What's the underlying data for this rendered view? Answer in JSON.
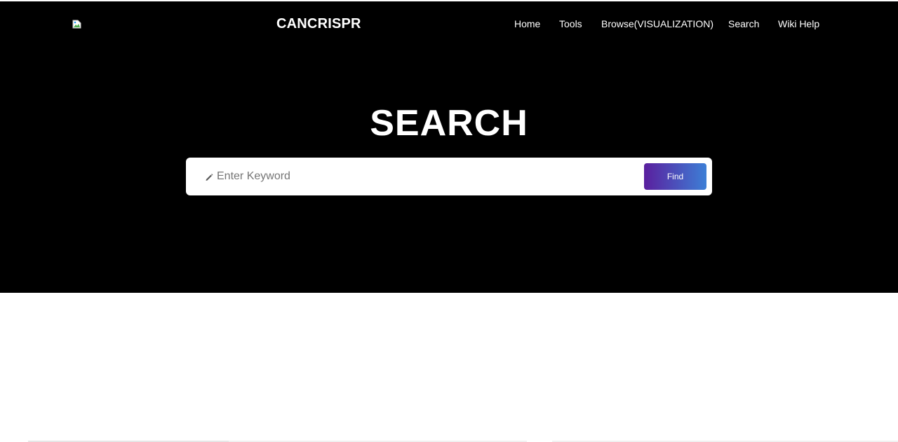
{
  "header": {
    "logo_icon": "broken-image-icon",
    "brand": "CANCRISPR",
    "nav": [
      {
        "label": "Home"
      },
      {
        "label": "Tools"
      },
      {
        "label": "Browse(VISUALIZATION)"
      },
      {
        "label": "Search"
      },
      {
        "label": "Wiki Help"
      }
    ]
  },
  "hero": {
    "title": "SEARCH"
  },
  "search": {
    "icon": "pencil-icon",
    "placeholder": "Enter Keyword",
    "value": "",
    "button_label": "Find"
  },
  "colors": {
    "hero_background": "#000000",
    "button_gradient_start": "#5a1f9e",
    "button_gradient_end": "#3d7fd6"
  }
}
